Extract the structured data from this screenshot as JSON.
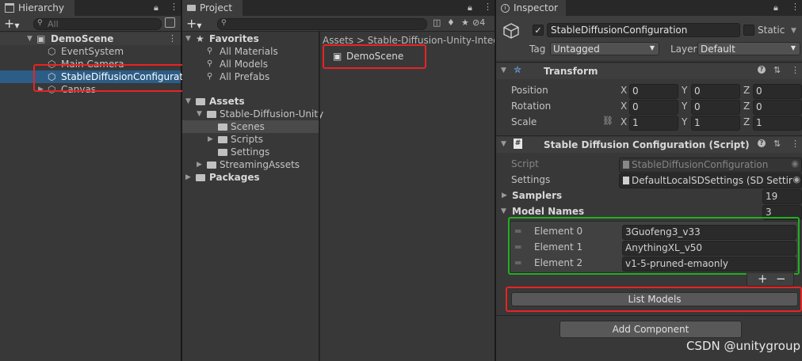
{
  "hierarchy": {
    "tab_label": "Hierarchy",
    "search_placeholder": "All",
    "scene_name": "DemoScene",
    "items": [
      "EventSystem",
      "Main Camera",
      "StableDiffusionConfigurati",
      "Canvas"
    ]
  },
  "project": {
    "tab_label": "Project",
    "favorites_label": "Favorites",
    "favorites": [
      "All Materials",
      "All Models",
      "All Prefabs"
    ],
    "assets_label": "Assets",
    "tree": [
      "Stable-Diffusion-Unity",
      "Scenes",
      "Scripts",
      "Settings",
      "StreamingAssets"
    ],
    "packages_label": "Packages",
    "breadcrumb": "Assets > Stable-Diffusion-Unity-Integ",
    "hidden_count": "4",
    "scene_asset": "DemoScene"
  },
  "inspector": {
    "tab_label": "Inspector",
    "object_name": "StableDiffusionConfiguration",
    "static_label": "Static",
    "tag_label": "Tag",
    "tag_value": "Untagged",
    "layer_label": "Layer",
    "layer_value": "Default",
    "transform": {
      "title": "Transform",
      "position_label": "Position",
      "rotation_label": "Rotation",
      "scale_label": "Scale",
      "x": "X",
      "y": "Y",
      "z": "Z",
      "position": [
        "0",
        "0",
        "0"
      ],
      "rotation": [
        "0",
        "0",
        "0"
      ],
      "scale": [
        "1",
        "1",
        "1"
      ]
    },
    "component": {
      "title": "Stable Diffusion Configuration (Script)",
      "script_label": "Script",
      "script_value": "StableDiffusionConfiguration",
      "settings_label": "Settings",
      "settings_value": "DefaultLocalSDSettings (SD Settin",
      "samplers_label": "Samplers",
      "samplers_count": "19",
      "model_names_label": "Model Names",
      "model_names_count": "3",
      "elements": [
        {
          "label": "Element 0",
          "value": "3Guofeng3_v33"
        },
        {
          "label": "Element 1",
          "value": "AnythingXL_v50"
        },
        {
          "label": "Element 2",
          "value": "v1-5-pruned-emaonly"
        }
      ],
      "add_symbol": "+",
      "remove_symbol": "−",
      "list_models_label": "List Models"
    },
    "add_component_label": "Add Component"
  },
  "watermark": "CSDN @unitygroup",
  "colors": {
    "selection": "#2c5d87",
    "highlight_red": "#e82323",
    "highlight_green": "#21b021"
  }
}
